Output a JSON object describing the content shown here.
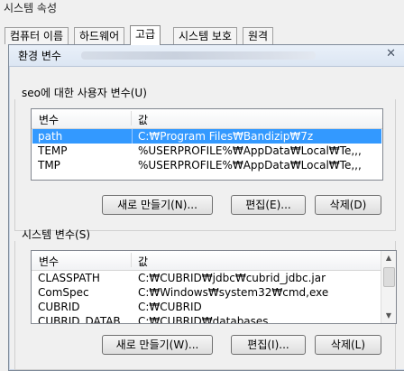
{
  "background_window": {
    "title": "시스템 속성",
    "tabs": [
      "컴퓨터 이름",
      "하드웨어",
      "고급",
      "시스템 보호",
      "원격"
    ],
    "active_tab": 2
  },
  "dialog": {
    "title": "환경 변수",
    "close_glyph": "✕",
    "user_vars": {
      "label": "seo에 대한 사용자 변수(U)",
      "col_name": "변수",
      "col_value": "값",
      "rows": [
        {
          "name": "path",
          "value": "C:₩Program Files₩Bandizip₩7z",
          "selected": true
        },
        {
          "name": "TEMP",
          "value": "%USERPROFILE%₩AppData₩Local₩Te,,,",
          "selected": false
        },
        {
          "name": "TMP",
          "value": "%USERPROFILE%₩AppData₩Local₩Te,,,",
          "selected": false
        }
      ],
      "buttons": {
        "new": "새로 만들기(N)...",
        "edit": "편집(E)...",
        "delete": "삭제(D)"
      }
    },
    "system_vars": {
      "label": "시스템 변수(S)",
      "col_name": "변수",
      "col_value": "값",
      "rows": [
        {
          "name": "CLASSPATH",
          "value": "C:₩CUBRID₩jdbc₩cubrid_jdbc.jar"
        },
        {
          "name": "ComSpec",
          "value": "C:₩Windows₩system32₩cmd,exe"
        },
        {
          "name": "CUBRID",
          "value": "C:₩CUBRID"
        },
        {
          "name": "CUBRID_DATAB",
          "value": "C:₩CUBRID₩databases"
        }
      ],
      "buttons": {
        "new": "새로 만들기(W)...",
        "edit": "편집(I)...",
        "delete": "삭제(L)"
      }
    },
    "icons": {
      "scroll_up": "scroll-up-icon",
      "scroll_down": "scroll-down-icon",
      "close": "close-icon"
    }
  }
}
